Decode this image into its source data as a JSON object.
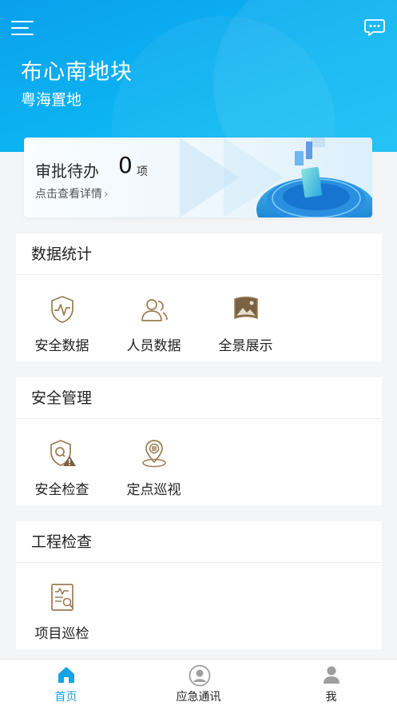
{
  "header": {
    "project_name": "布心南地块",
    "company": "粤海置地",
    "menu_icon": "menu-icon",
    "chat_icon": "chat-icon",
    "bg_color": "#0db6f3"
  },
  "approval": {
    "title": "审批待办",
    "count": "0",
    "unit": "项",
    "link": "点击查看详情",
    "chevron": "›"
  },
  "sections": [
    {
      "title": "数据统计",
      "items": [
        {
          "label": "安全数据",
          "icon": "shield-pulse-icon"
        },
        {
          "label": "人员数据",
          "icon": "people-icon"
        },
        {
          "label": "全景展示",
          "icon": "panorama-icon"
        }
      ]
    },
    {
      "title": "安全管理",
      "items": [
        {
          "label": "安全检查",
          "icon": "shield-warning-icon"
        },
        {
          "label": "定点巡视",
          "icon": "location-pin-icon"
        }
      ]
    },
    {
      "title": "工程检查",
      "items": [
        {
          "label": "项目巡检",
          "icon": "document-search-icon"
        }
      ]
    }
  ],
  "tabbar": {
    "items": [
      {
        "label": "首页",
        "icon": "home-icon",
        "active": true
      },
      {
        "label": "应急通讯",
        "icon": "contact-icon",
        "active": false
      },
      {
        "label": "我",
        "icon": "user-icon",
        "active": false
      }
    ],
    "active_color": "#16a3e8"
  },
  "icon_color": "#9a7b52"
}
